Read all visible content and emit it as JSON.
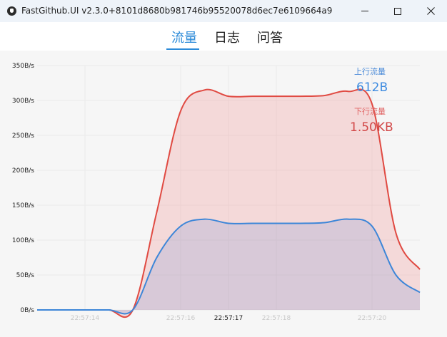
{
  "window": {
    "title": "FastGithub.UI v2.3.0+8101d8680b981746b95520078d6ec7e6109664a9"
  },
  "tabs": [
    {
      "label": "流量",
      "selected": true
    },
    {
      "label": "日志",
      "selected": false
    },
    {
      "label": "问答",
      "selected": false
    }
  ],
  "legend": {
    "upload_label": "上行流量",
    "upload_value": "612B",
    "download_label": "下行流量",
    "download_value": "1.50KB"
  },
  "colors": {
    "accent": "#2b8ad8",
    "upload_line": "#3d86d8",
    "download_line": "#e04a42"
  },
  "chart_data": {
    "type": "area",
    "ylim": [
      0,
      350
    ],
    "yticks": [
      "0B/s",
      "50B/s",
      "100B/s",
      "150B/s",
      "200B/s",
      "250B/s",
      "300B/s",
      "350B/s"
    ],
    "xticks": [
      {
        "label": "22:57:14",
        "t": 1,
        "active": false
      },
      {
        "label": "22:57:16",
        "t": 3,
        "active": false
      },
      {
        "label": "22:57:17",
        "t": 4,
        "active": true
      },
      {
        "label": "22:57:18",
        "t": 5,
        "active": false
      },
      {
        "label": "22:57:20",
        "t": 7,
        "active": false
      }
    ],
    "x": [
      0,
      0.5,
      1,
      1.5,
      2,
      2.5,
      3,
      3.5,
      4,
      4.5,
      5,
      5.5,
      6,
      6.5,
      7,
      7.5,
      8
    ],
    "series": [
      {
        "name": "上行流量",
        "values": [
          0,
          0,
          0,
          0,
          0,
          75,
          120,
          130,
          124,
          124,
          124,
          124,
          125,
          130,
          120,
          50,
          25
        ]
      },
      {
        "name": "下行流量",
        "values": [
          0,
          0,
          0,
          0,
          0,
          140,
          285,
          315,
          306,
          306,
          306,
          306,
          307,
          313,
          295,
          110,
          58
        ]
      }
    ],
    "grid": true
  }
}
